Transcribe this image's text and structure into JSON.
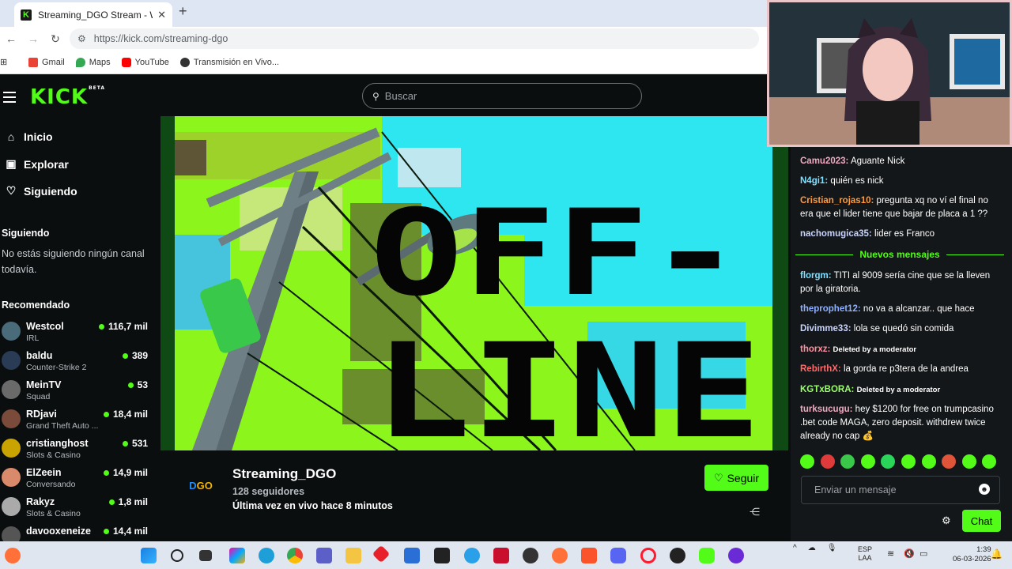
{
  "browser": {
    "tab_title": "Streaming_DGO Stream - Watch",
    "url": "https://kick.com/streaming-dgo",
    "bookmarks": [
      {
        "label": "Gmail",
        "color": "#ea4335"
      },
      {
        "label": "Maps",
        "color": "#34a853"
      },
      {
        "label": "YouTube",
        "color": "#ff0000"
      },
      {
        "label": "Transmisión en Vivo...",
        "color": "#333333"
      }
    ]
  },
  "site": {
    "logo": "KICK",
    "logo_tag": "BETA",
    "search_placeholder": "Buscar",
    "accent": "#53fc18"
  },
  "nav": [
    {
      "label": "Inicio",
      "icon": "home-icon"
    },
    {
      "label": "Explorar",
      "icon": "compass-icon"
    },
    {
      "label": "Siguiendo",
      "icon": "heart-icon"
    }
  ],
  "following": {
    "title": "Siguiendo",
    "empty_text": "No estás siguiendo ningún canal todavía."
  },
  "recommended": {
    "title": "Recomendado",
    "items": [
      {
        "name": "Westcol",
        "category": "IRL",
        "viewers": "116,7 mil",
        "color": "#4a6b7a"
      },
      {
        "name": "baldu",
        "category": "Counter-Strike 2",
        "viewers": "389",
        "color": "#2a3b55"
      },
      {
        "name": "MeinTV",
        "category": "Squad",
        "viewers": "53",
        "color": "#6a6a6a"
      },
      {
        "name": "RDjavi",
        "category": "Grand Theft Auto ...",
        "viewers": "18,4 mil",
        "color": "#7a4a3a"
      },
      {
        "name": "cristianghost",
        "category": "Slots & Casino",
        "viewers": "531",
        "color": "#c9a400"
      },
      {
        "name": "ElZeein",
        "category": "Conversando",
        "viewers": "14,9 mil",
        "color": "#d88a6a"
      },
      {
        "name": "Rakyz",
        "category": "Slots & Casino",
        "viewers": "1,8 mil",
        "color": "#aaaaaa"
      },
      {
        "name": "davooxeneize",
        "category": "",
        "viewers": "14,4 mil",
        "color": "#555555"
      }
    ]
  },
  "player": {
    "offline_line1": "OFF-",
    "offline_line2": "LINE"
  },
  "channel": {
    "logo_text_1": "D",
    "logo_text_2": "GO",
    "name": "Streaming_DGO",
    "followers": "128 seguidores",
    "last_live": "Última vez en vivo hace 8 minutos",
    "follow_label": "Seguir"
  },
  "chat": {
    "messages_old": [
      {
        "user": "Camu2023",
        "color": "#f0a8c0",
        "text": "Aguante Nick"
      },
      {
        "user": "N4gi1",
        "color": "#7fe0ff",
        "text": "quién es nick"
      },
      {
        "user": "Cristian_rojas10",
        "color": "#ff9a3c",
        "text": "pregunta xq no ví el final no era que el lider tiene que bajar de placa a 1 ??"
      },
      {
        "user": "nachomugica35",
        "color": "#c8d4ff",
        "text": "lider es Franco"
      }
    ],
    "new_messages_label": "Nuevos mensajes",
    "messages_new": [
      {
        "user": "florgm",
        "color": "#7fe0ff",
        "text": "TITI al 9009 sería cine que se la lleven por la giratoria.",
        "deleted": false
      },
      {
        "user": "theprophet12",
        "color": "#8fb0ff",
        "text": "no va a alcanzar.. que hace",
        "deleted": false
      },
      {
        "user": "Divimme33",
        "color": "#c8d4ff",
        "text": "lola se quedó sin comida",
        "deleted": false
      },
      {
        "user": "thorxz",
        "color": "#ff8fa0",
        "text": "Deleted by a moderator",
        "deleted": true
      },
      {
        "user": "RebirthX",
        "color": "#ff6a6a",
        "text": "la gorda re p3tera de la andrea",
        "deleted": false
      },
      {
        "user": "KGTxBORA",
        "color": "#9aff6a",
        "text": "Deleted by a moderator",
        "deleted": true
      },
      {
        "user": "turksucugu",
        "color": "#f0a8c0",
        "text": "hey $1200 for free on trumpcasino .bet code MAGA, zero deposit. withdrew twice already no cap 💰",
        "deleted": false
      }
    ],
    "input_placeholder": "Enviar un mensaje",
    "send_label": "Chat"
  },
  "system": {
    "lang_1": "ESP",
    "lang_2": "LAA",
    "time": "1:39",
    "date": "06-03-2026"
  }
}
